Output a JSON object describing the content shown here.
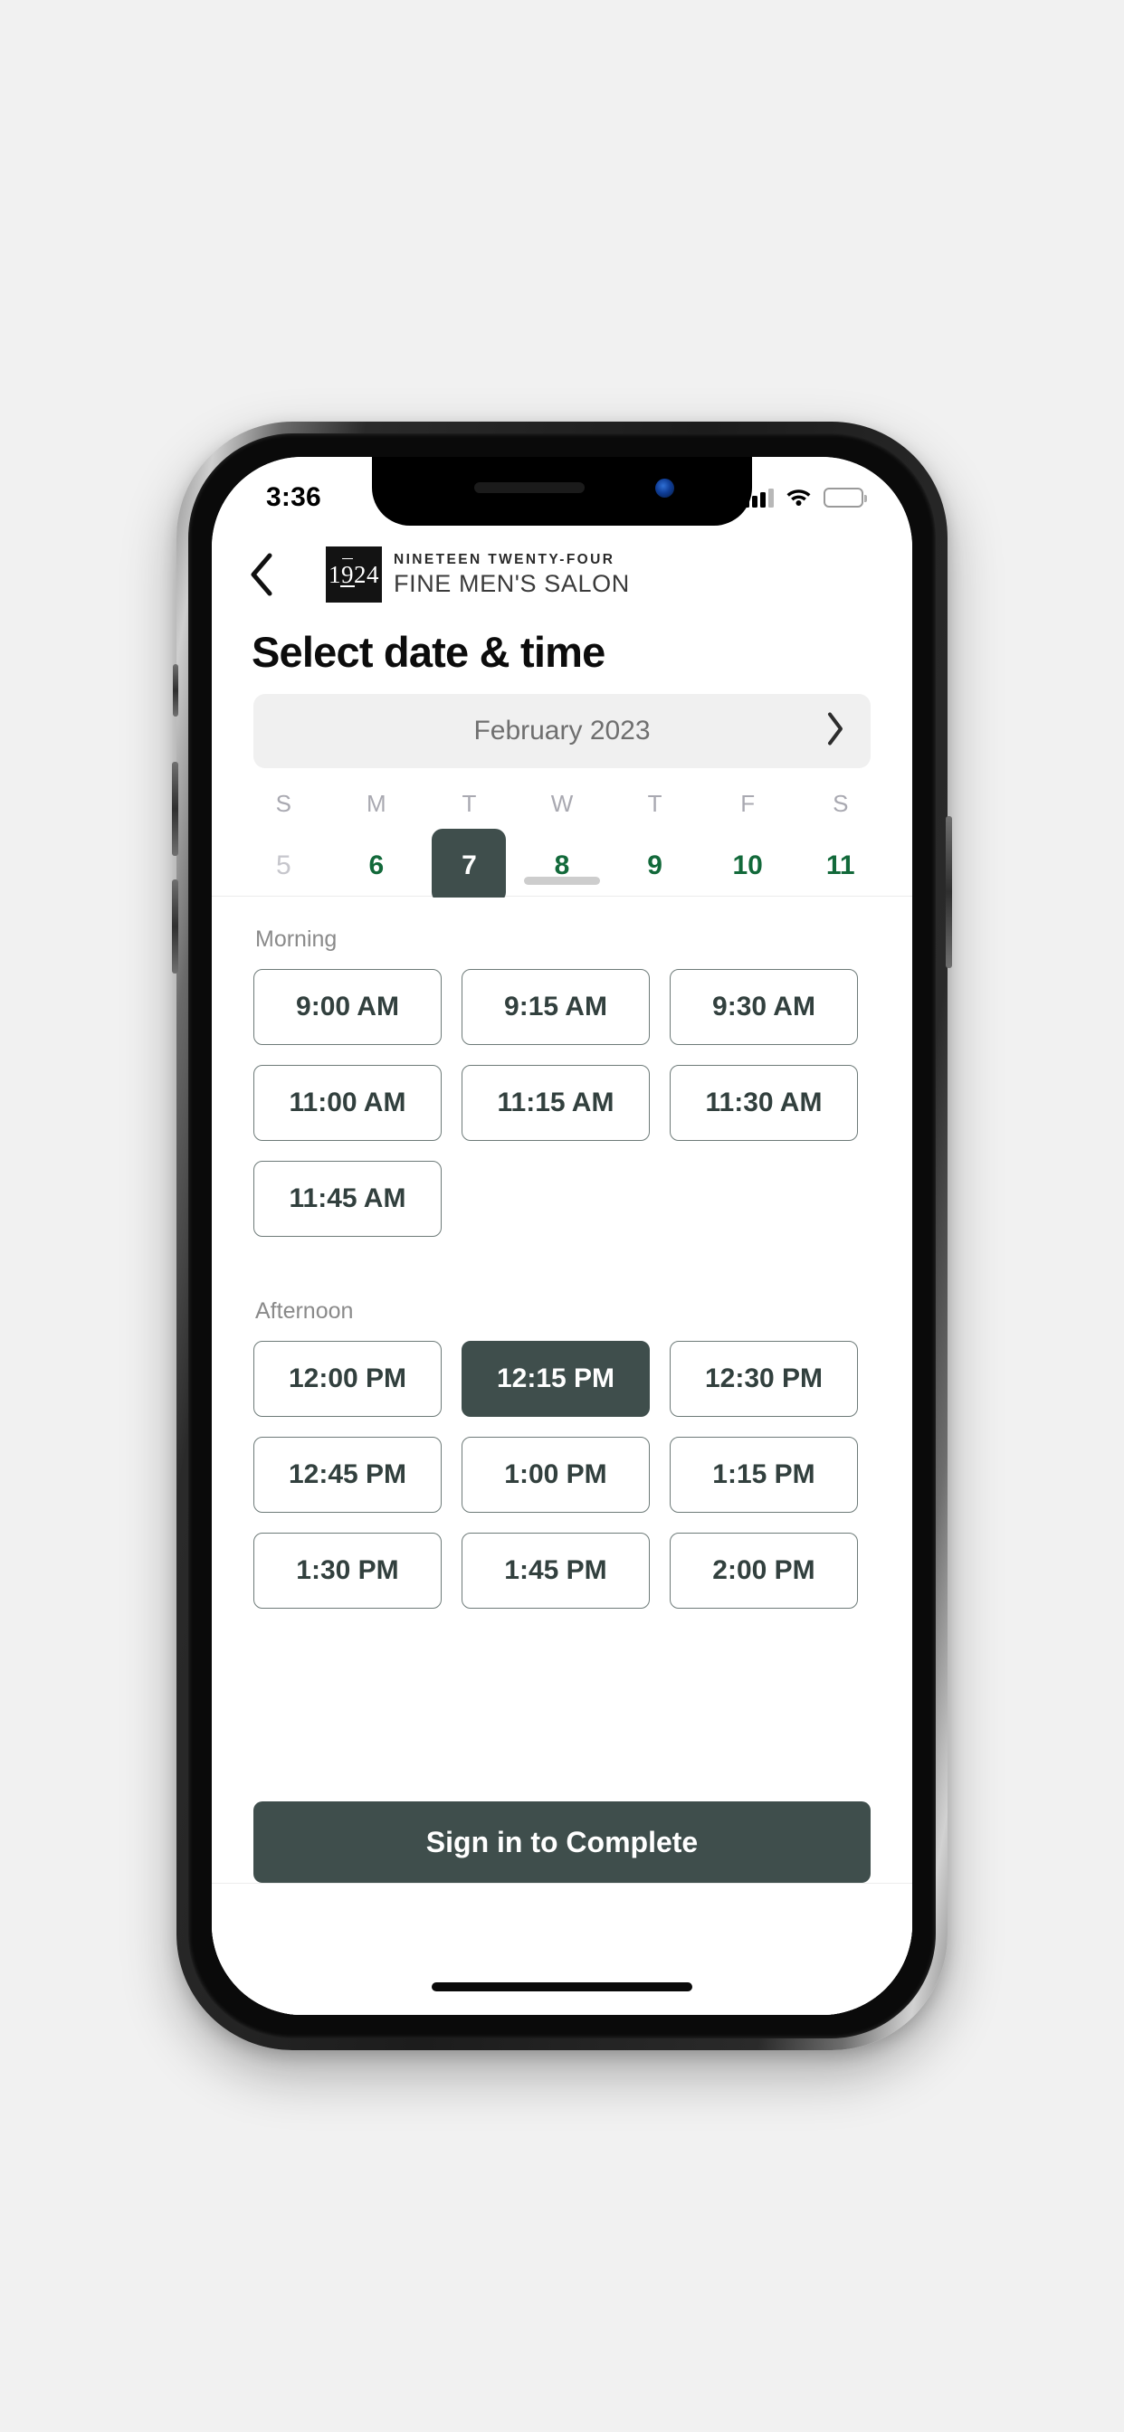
{
  "status_bar": {
    "time": "3:36",
    "signal_icon": "cellular-signal-icon",
    "wifi_icon": "wifi-icon",
    "battery_icon": "battery-icon",
    "battery_color": "#f9c300"
  },
  "header": {
    "back_icon": "chevron-left-icon",
    "logo_mark_text": "1924",
    "logo_line1": "NINETEEN TWENTY-FOUR",
    "logo_line2": "FINE MEN'S SALON"
  },
  "page_title": "Select date & time",
  "calendar": {
    "month_label": "February 2023",
    "next_month_icon": "chevron-right-icon",
    "weekdays": [
      "S",
      "M",
      "T",
      "W",
      "T",
      "F",
      "S"
    ],
    "dates": [
      {
        "day": "5",
        "state": "disabled"
      },
      {
        "day": "6",
        "state": "available"
      },
      {
        "day": "7",
        "state": "selected"
      },
      {
        "day": "8",
        "state": "available"
      },
      {
        "day": "9",
        "state": "available"
      },
      {
        "day": "10",
        "state": "available"
      },
      {
        "day": "11",
        "state": "available"
      }
    ],
    "available_color": "#12693a",
    "selected_color": "#3f4e4c"
  },
  "sections": [
    {
      "title": "Morning",
      "slots": [
        {
          "label": "9:00 AM",
          "state": "available"
        },
        {
          "label": "9:15 AM",
          "state": "available"
        },
        {
          "label": "9:30 AM",
          "state": "available"
        },
        {
          "label": "11:00 AM",
          "state": "available"
        },
        {
          "label": "11:15 AM",
          "state": "available"
        },
        {
          "label": "11:30 AM",
          "state": "available"
        },
        {
          "label": "11:45 AM",
          "state": "available"
        }
      ]
    },
    {
      "title": "Afternoon",
      "slots": [
        {
          "label": "12:00 PM",
          "state": "available"
        },
        {
          "label": "12:15 PM",
          "state": "selected"
        },
        {
          "label": "12:30 PM",
          "state": "available"
        },
        {
          "label": "12:45 PM",
          "state": "available"
        },
        {
          "label": "1:00 PM",
          "state": "available"
        },
        {
          "label": "1:15 PM",
          "state": "available"
        },
        {
          "label": "1:30 PM",
          "state": "available"
        },
        {
          "label": "1:45 PM",
          "state": "available"
        },
        {
          "label": "2:00 PM",
          "state": "available"
        }
      ]
    }
  ],
  "cta": {
    "label": "Sign in to Complete",
    "color": "#3f4e4c"
  }
}
